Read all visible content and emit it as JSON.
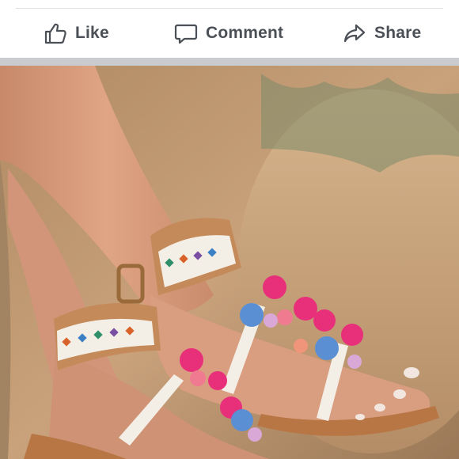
{
  "actions": {
    "like_label": "Like",
    "comment_label": "Comment",
    "share_label": "Share"
  },
  "icons": {
    "like": "thumbs-up-icon",
    "comment": "speech-bubble-icon",
    "share": "share-arrow-icon"
  },
  "colors": {
    "action_text": "#4b4f56",
    "divider": "#c9cbcf",
    "strap_tan": "#c58a5a",
    "pompom_pink": "#e8307a",
    "pompom_blue": "#5b8fd4"
  }
}
